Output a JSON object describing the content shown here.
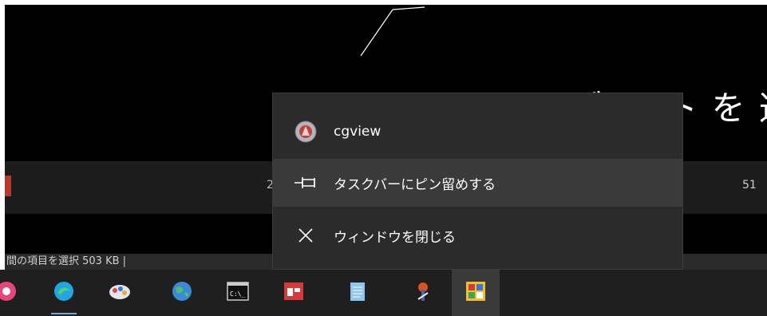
{
  "background": {
    "title_fragment": "ホ ー ト ラ ブ ー ト を 選 択 し",
    "row_mid_text": "2",
    "row_right_text": "51",
    "status_text": "間の項目を選択  503 KB  |"
  },
  "jump_list": {
    "app_name": "cgview",
    "pin_label": "タスクバーにピン留めする",
    "close_label": "ウィンドウを閉じる"
  },
  "taskbar": {
    "buttons": [
      {
        "name": "pink-app-icon",
        "color": "#e8457a"
      },
      {
        "name": "edge-icon",
        "color": "#1ea7e1"
      },
      {
        "name": "paint-icon",
        "color": "#d84a4a"
      },
      {
        "name": "globe-icon",
        "color": "#3aa55a"
      },
      {
        "name": "cmd-icon",
        "color": "#cccccc"
      },
      {
        "name": "red-window-icon",
        "color": "#d33a3a"
      },
      {
        "name": "notepad-icon",
        "color": "#8fc6ee"
      },
      {
        "name": "tool-icon",
        "color": "#d9541e"
      },
      {
        "name": "cgview-icon",
        "color": "#f0c030"
      }
    ]
  }
}
